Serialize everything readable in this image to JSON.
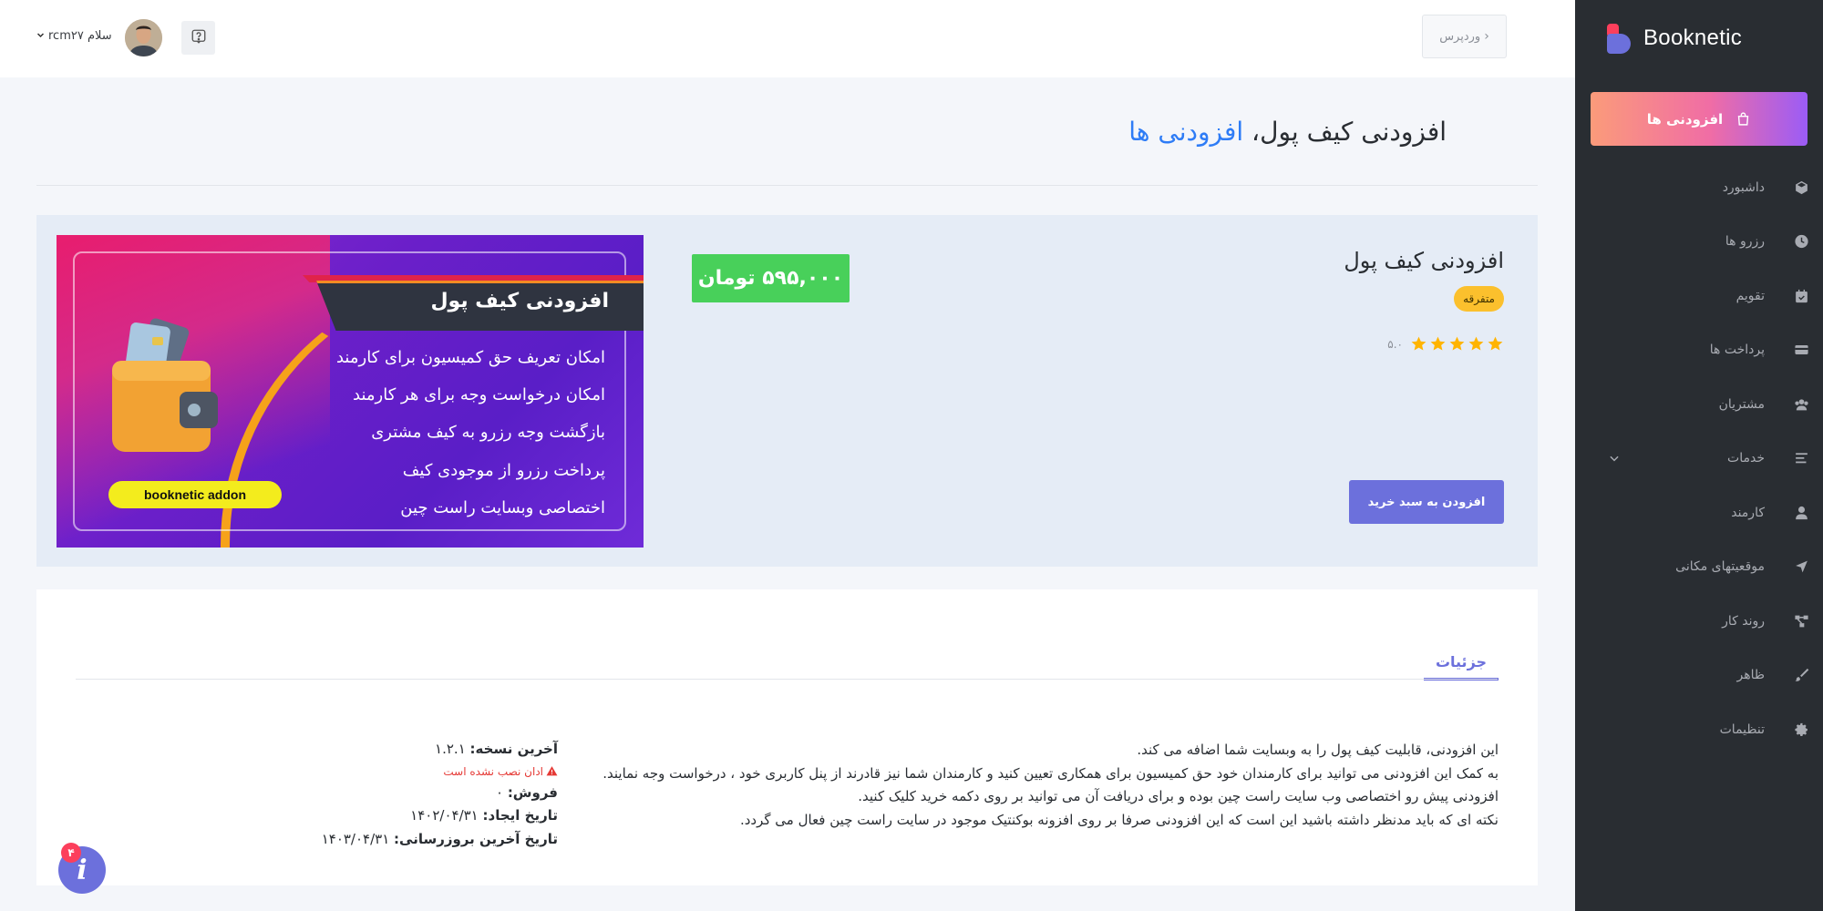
{
  "sidebar": {
    "logo_text": "Booknetic",
    "addons_label": "افزودنی ها",
    "items": [
      {
        "label": "داشبورد",
        "icon": "cube-icon"
      },
      {
        "label": "رزرو ها",
        "icon": "clock-icon"
      },
      {
        "label": "تقویم",
        "icon": "calendar-icon"
      },
      {
        "label": "پرداخت ها",
        "icon": "credit-card-icon"
      },
      {
        "label": "مشتریان",
        "icon": "users-icon"
      },
      {
        "label": "خدمات",
        "icon": "list-icon"
      },
      {
        "label": "کارمند",
        "icon": "user-icon"
      },
      {
        "label": "موقعیتهای مکانی",
        "icon": "location-arrow-icon"
      },
      {
        "label": "روند کار",
        "icon": "workflow-icon"
      },
      {
        "label": "ظاهر",
        "icon": "brush-icon"
      },
      {
        "label": "تنظیمات",
        "icon": "gear-icon"
      }
    ]
  },
  "topbar": {
    "wordpress_label": "وردپرس",
    "greeting": "سلام rcm۲۷"
  },
  "page": {
    "title": "افزودنی کیف پول",
    "separator": "،",
    "breadcrumb": "افزودنی ها"
  },
  "addon": {
    "name": "افزودنی کیف پول",
    "category": "متفرقه",
    "rating": 5,
    "rating_text": "۵.۰",
    "price": "۵۹۵,۰۰۰ تومان",
    "cart_label": "افزودن به سبد خرید",
    "banner": {
      "title": "افزودنی کیف پول",
      "features": [
        "امکان تعریف حق کمیسیون برای کارمند",
        "امکان درخواست وجه برای هر کارمند",
        "بازگشت وجه رزرو به کیف مشتری",
        "پرداخت رزرو از موجودی کیف",
        "اختصاصی وبسایت راست چین"
      ],
      "pill": "booknetic addon"
    }
  },
  "details": {
    "tab_label": "جزئیات",
    "description": [
      "این افزودنی، قابلیت کیف پول را به وبسایت شما اضافه می کند.",
      "به کمک این افزودنی می توانید برای کارمندان خود حق کمیسیون برای همکاری تعیین کنید و کارمندان شما نیز قادرند از پنل کاربری خود ، درخواست وجه نمایند.",
      "افزودنی پیش رو اختصاصی وب سایت راست چین بوده و برای دریافت آن می توانید بر روی دکمه خرید کلیک کنید.",
      "نکته ای که باید مدنظر داشته باشید این است که این افزودنی صرفا بر روی افزونه بوکنتیک موجود در سایت راست چین فعال می گردد."
    ],
    "version_label": "آخرین نسخه:",
    "version": "۱.۲.۱",
    "not_installed": "ادان نصب نشده است",
    "sales_label": "فروش:",
    "sales": "۰",
    "created_label": "تاریخ ایجاد:",
    "created": "۱۴۰۲/۰۴/۳۱",
    "updated_label": "تاریخ آخرین بروزرسانی:",
    "updated": "۱۴۰۳/۰۴/۳۱"
  },
  "info_badge": "۴",
  "colors": {
    "sidebar_bg": "#292d32",
    "accent": "#6c70dc",
    "link": "#2e7cf6",
    "price_green": "#48d05a",
    "category_yellow": "#fbc02d",
    "star": "#ffb400"
  }
}
